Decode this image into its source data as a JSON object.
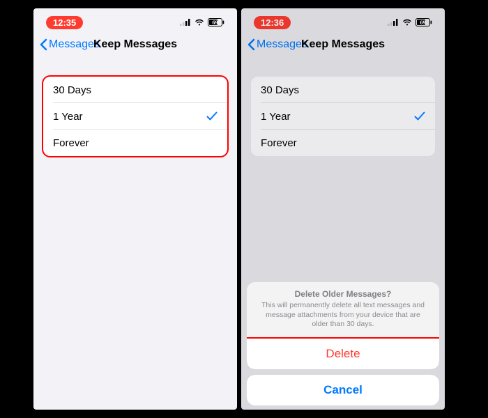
{
  "status": {
    "time": "12:35",
    "time_alt": "12:36",
    "battery": "69"
  },
  "nav": {
    "back": "Messages",
    "title": "Keep Messages"
  },
  "options": {
    "opt1": "30 Days",
    "opt2": "1 Year",
    "opt3": "Forever"
  },
  "sheet": {
    "title": "Delete Older Messages?",
    "message": "This will permanently delete all text messages and message attachments from your device that are older than 30 days.",
    "delete": "Delete",
    "cancel": "Cancel"
  }
}
